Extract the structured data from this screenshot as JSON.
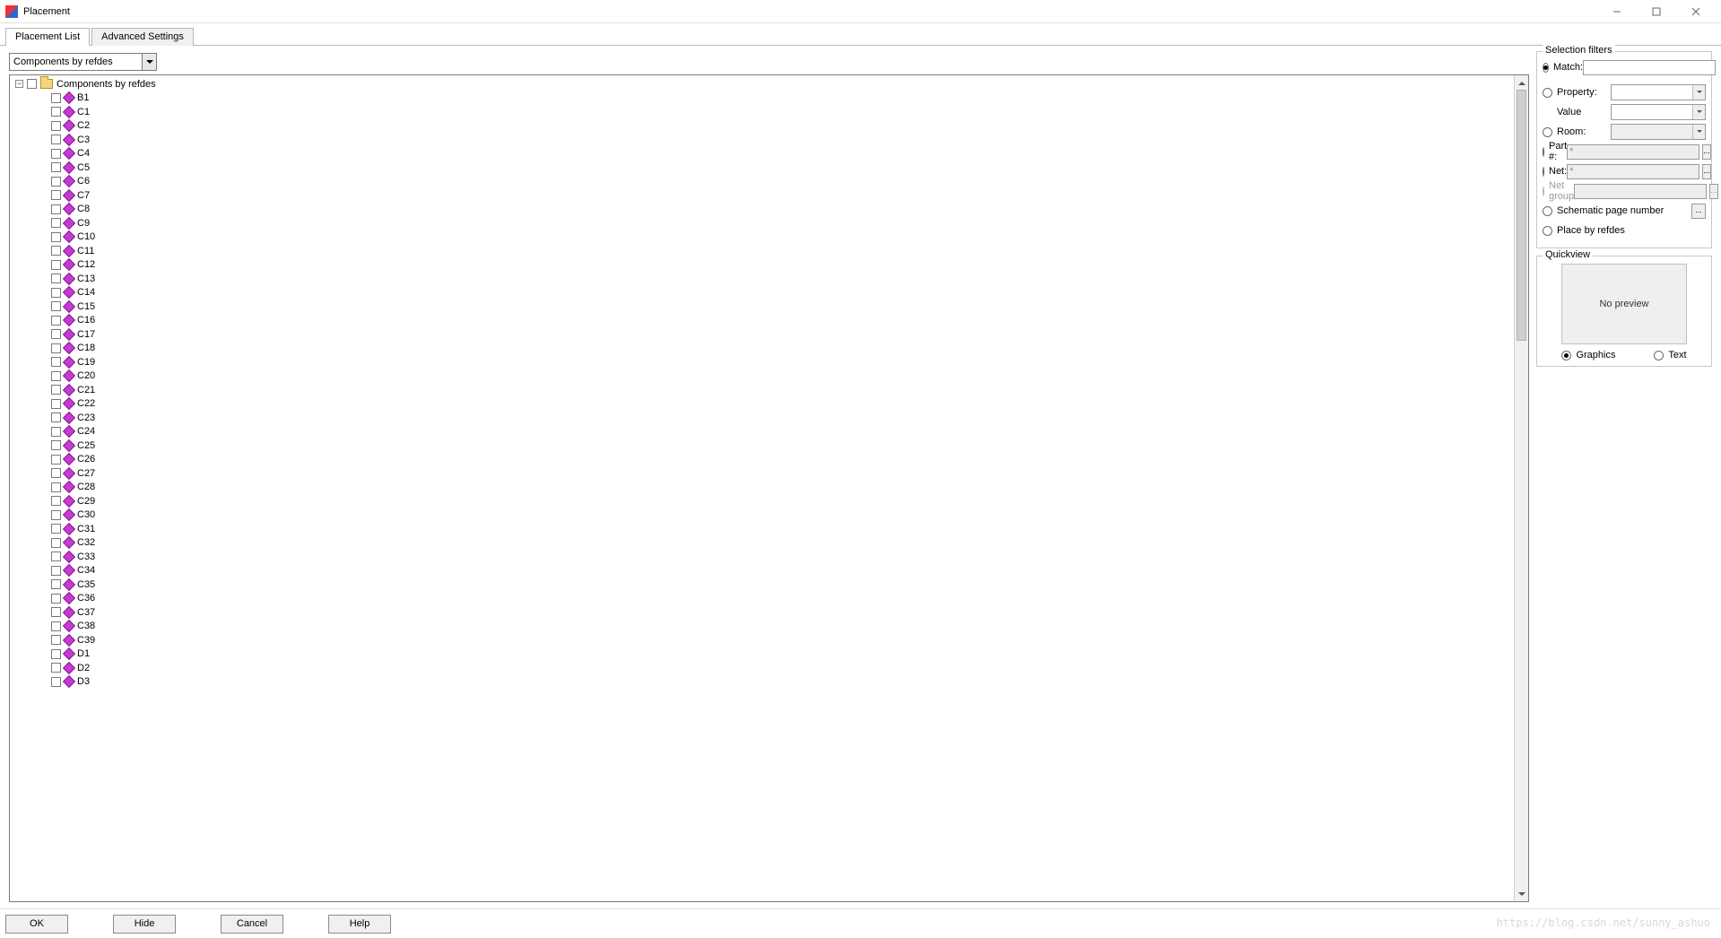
{
  "window": {
    "title": "Placement"
  },
  "tabs": [
    {
      "label": "Placement List",
      "active": true
    },
    {
      "label": "Advanced Settings",
      "active": false
    }
  ],
  "dropdown": {
    "selected": "Components by refdes"
  },
  "tree": {
    "root_label": "Components by refdes",
    "items": [
      "B1",
      "C1",
      "C2",
      "C3",
      "C4",
      "C5",
      "C6",
      "C7",
      "C8",
      "C9",
      "C10",
      "C11",
      "C12",
      "C13",
      "C14",
      "C15",
      "C16",
      "C17",
      "C18",
      "C19",
      "C20",
      "C21",
      "C22",
      "C23",
      "C24",
      "C25",
      "C26",
      "C27",
      "C28",
      "C29",
      "C30",
      "C31",
      "C32",
      "C33",
      "C34",
      "C35",
      "C36",
      "C37",
      "C38",
      "C39",
      "D1",
      "D2",
      "D3"
    ]
  },
  "filters": {
    "legend": "Selection filters",
    "match": {
      "label": "Match:",
      "value": "",
      "checked": true
    },
    "property": {
      "label": "Property:",
      "checked": false
    },
    "value": {
      "label": "Value"
    },
    "room": {
      "label": "Room:",
      "checked": false
    },
    "part": {
      "label": "Part #:",
      "checked": false,
      "value": "*"
    },
    "net": {
      "label": "Net:",
      "checked": false,
      "value": "*"
    },
    "netgroup": {
      "label": "Net group",
      "checked": false,
      "disabled": true
    },
    "schematic": {
      "label": "Schematic page number",
      "checked": false
    },
    "placeby": {
      "label": "Place by refdes",
      "checked": false
    }
  },
  "quickview": {
    "legend": "Quickview",
    "preview_text": "No preview",
    "graphics_label": "Graphics",
    "text_label": "Text",
    "mode": "graphics"
  },
  "buttons": {
    "ok": "OK",
    "hide": "Hide",
    "cancel": "Cancel",
    "help": "Help"
  },
  "watermark": "https://blog.csdn.net/sunny_ashuo"
}
